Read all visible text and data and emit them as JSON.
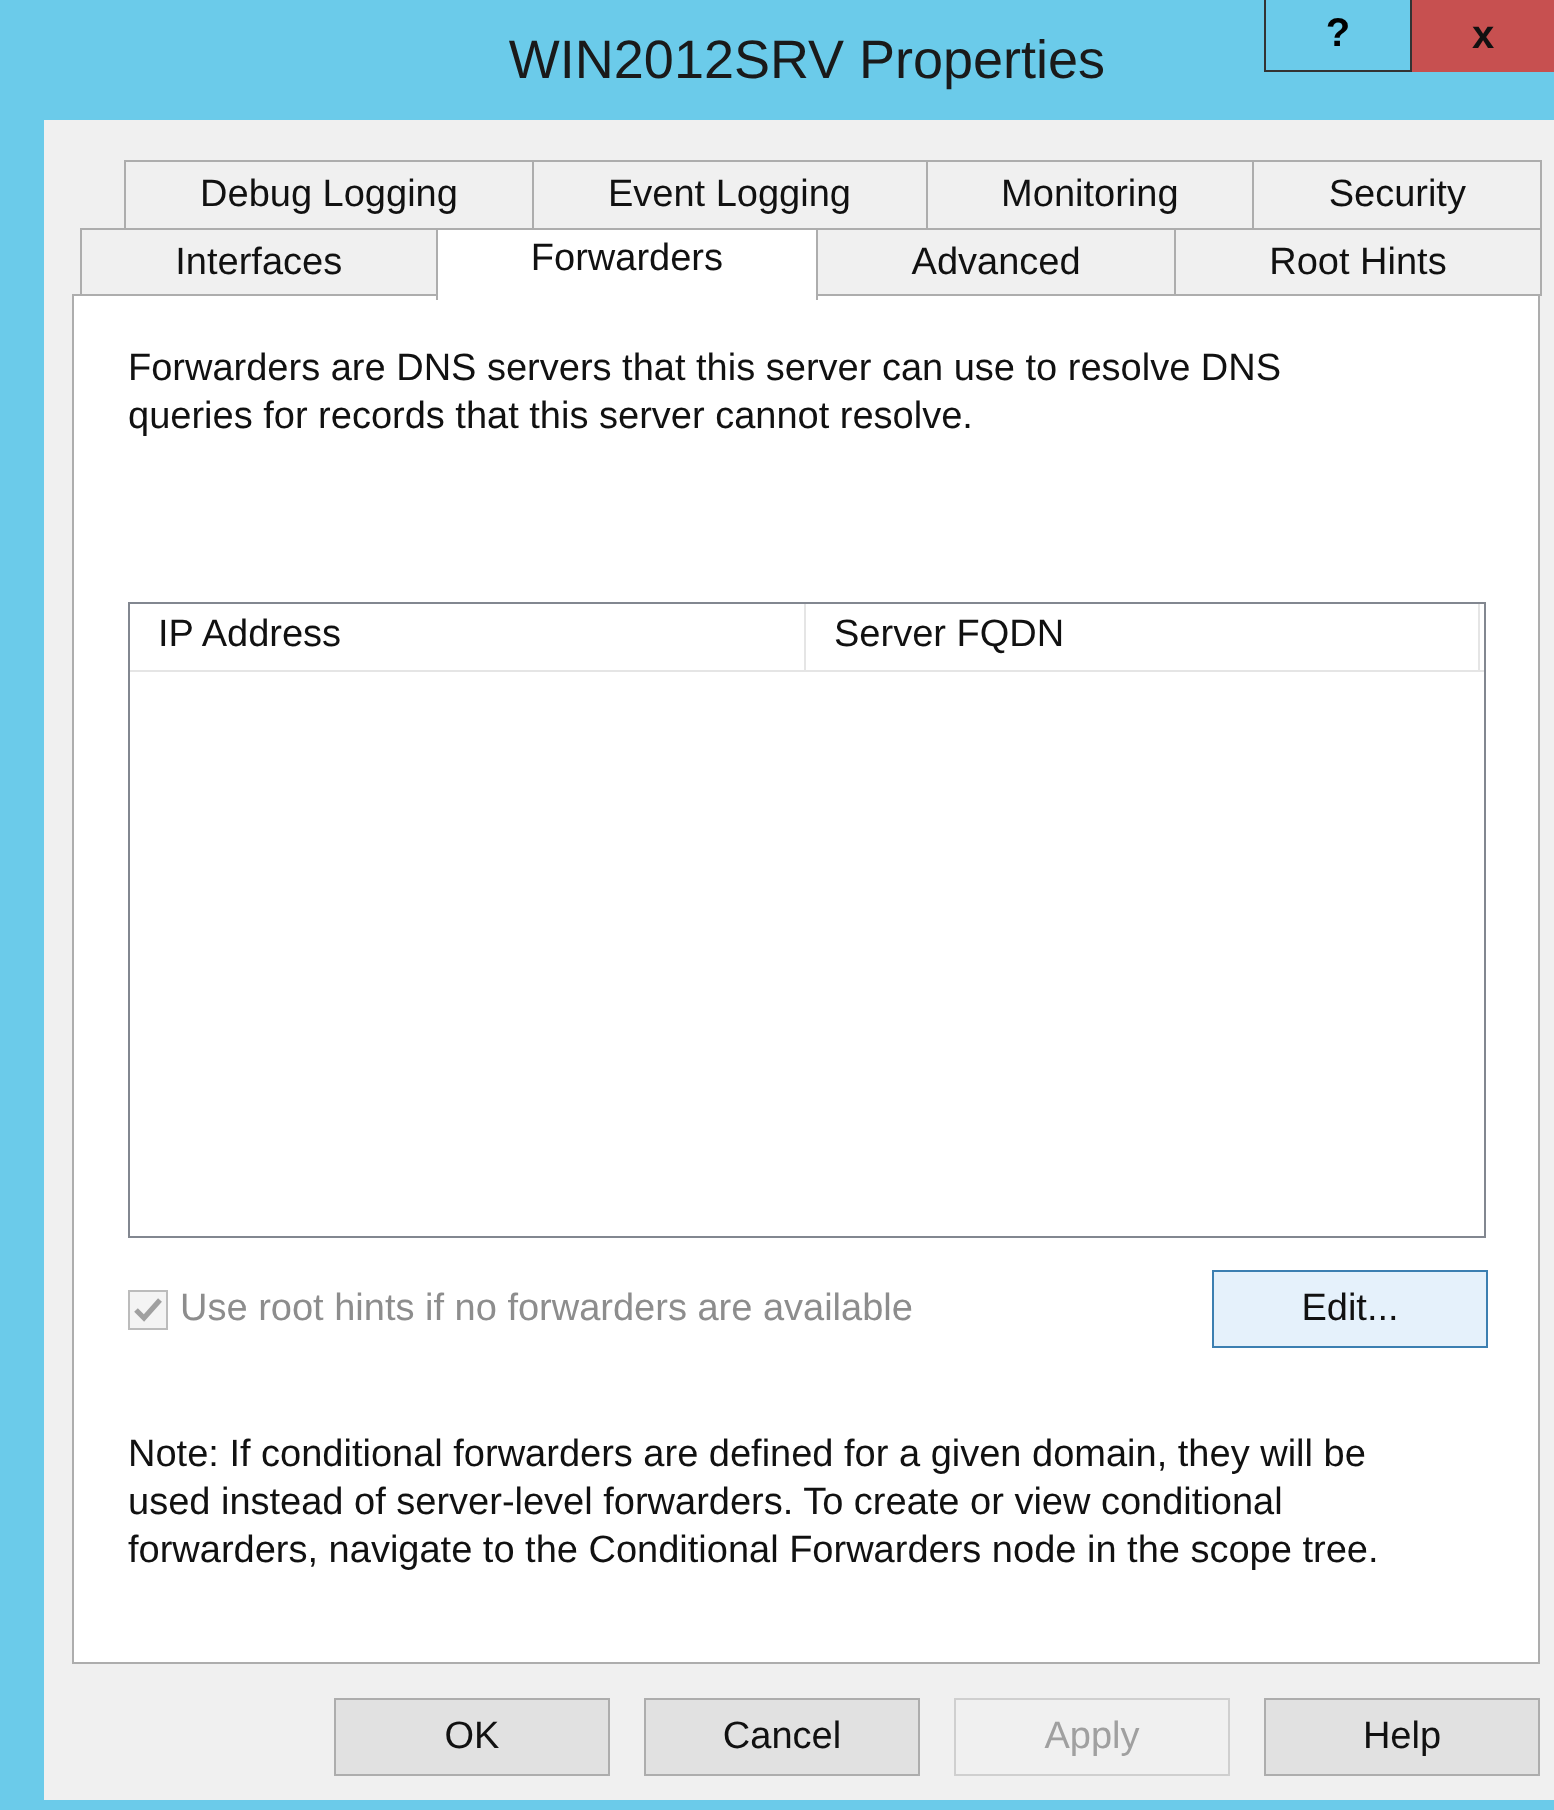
{
  "window": {
    "title": "WIN2012SRV Properties",
    "help_label": "?",
    "close_label": "x"
  },
  "tab_rows": [
    [
      {
        "label": "Debug Logging",
        "selected": false
      },
      {
        "label": "Event Logging",
        "selected": false
      },
      {
        "label": "Monitoring",
        "selected": false
      },
      {
        "label": "Security",
        "selected": false
      }
    ],
    [
      {
        "label": "Interfaces",
        "selected": false
      },
      {
        "label": "Forwarders",
        "selected": true
      },
      {
        "label": "Advanced",
        "selected": false
      },
      {
        "label": "Root Hints",
        "selected": false
      }
    ]
  ],
  "description": "Forwarders are DNS servers that this server can use to resolve DNS queries for records that this server cannot resolve.",
  "table": {
    "columns": [
      "IP Address",
      "Server FQDN"
    ]
  },
  "root_hints_checkbox": {
    "label": "Use root hints if no forwarders are available",
    "checked": true,
    "disabled": true
  },
  "edit_button": {
    "label": "Edit...",
    "disabled": false
  },
  "note": "Note: If conditional forwarders are defined for a given domain, they will be used instead of server-level forwarders.  To create or view conditional forwarders, navigate to the Conditional Forwarders node in the scope tree.",
  "buttons": [
    {
      "label": "OK",
      "disabled": false
    },
    {
      "label": "Cancel",
      "disabled": false
    },
    {
      "label": "Apply",
      "disabled": true
    },
    {
      "label": "Help",
      "disabled": false
    }
  ]
}
